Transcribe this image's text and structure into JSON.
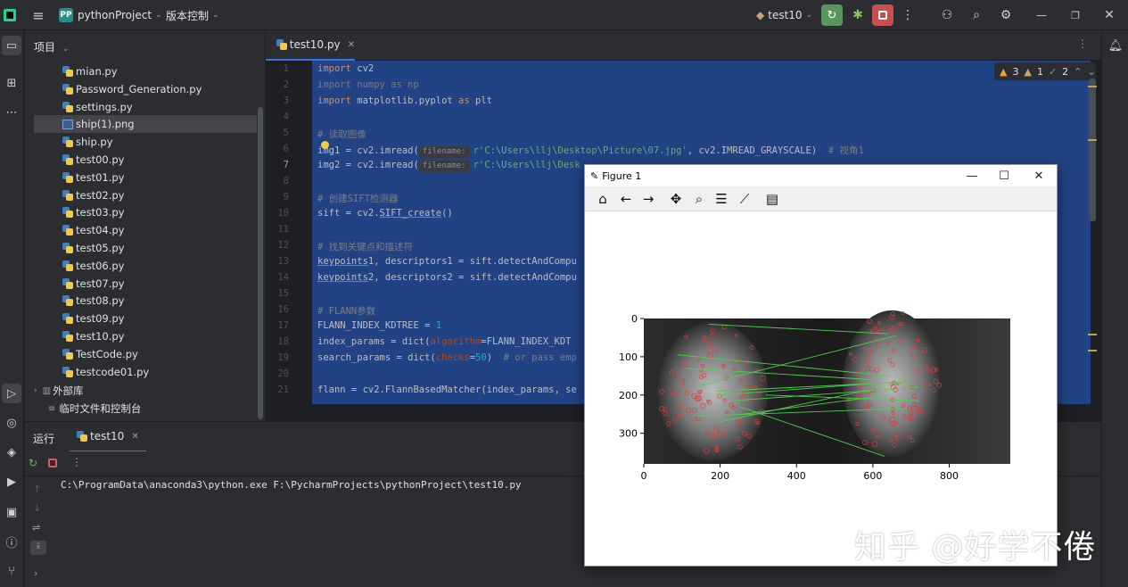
{
  "titlebar": {
    "project_badge": "PP",
    "project_name": "pythonProject",
    "vcs_label": "版本控制",
    "run_config": "test10",
    "icons": [
      "menu-icon",
      "run-icon",
      "debug-icon",
      "stop-icon",
      "more-icon",
      "add-user-icon",
      "search-icon",
      "settings-icon"
    ]
  },
  "project_panel": {
    "header": "项目",
    "files": [
      {
        "name": "mian.py",
        "type": "py"
      },
      {
        "name": "Password_Generation.py",
        "type": "py"
      },
      {
        "name": "settings.py",
        "type": "py"
      },
      {
        "name": "ship(1).png",
        "type": "png",
        "selected": true
      },
      {
        "name": "ship.py",
        "type": "py"
      },
      {
        "name": "test00.py",
        "type": "py"
      },
      {
        "name": "test01.py",
        "type": "py"
      },
      {
        "name": "test02.py",
        "type": "py"
      },
      {
        "name": "test03.py",
        "type": "py"
      },
      {
        "name": "test04.py",
        "type": "py"
      },
      {
        "name": "test05.py",
        "type": "py"
      },
      {
        "name": "test06.py",
        "type": "py"
      },
      {
        "name": "test07.py",
        "type": "py"
      },
      {
        "name": "test08.py",
        "type": "py"
      },
      {
        "name": "test09.py",
        "type": "py"
      },
      {
        "name": "test10.py",
        "type": "py"
      },
      {
        "name": "TestCode.py",
        "type": "py"
      },
      {
        "name": "testcode01.py",
        "type": "py"
      }
    ],
    "external_libs": "外部库",
    "scratches": "临时文件和控制台"
  },
  "editor": {
    "tab_label": "test10.py",
    "inspections": {
      "errors": "3",
      "warnings": "1",
      "ok": "2"
    },
    "line_numbers": [
      "1",
      "2",
      "3",
      "4",
      "5",
      "6",
      "7",
      "8",
      "9",
      "10",
      "11",
      "12",
      "13",
      "14",
      "15",
      "16",
      "17",
      "18",
      "19",
      "20",
      "21"
    ],
    "code": {
      "l1_kw": "import",
      "l1_rest": " cv2",
      "l2": "import numpy as np",
      "l3_kw": "import",
      "l3_mid": " matplotlib.pyplot ",
      "l3_kw2": "as",
      "l3_end": " plt",
      "l5": "# 读取图像",
      "l6_a": "img1 = cv2.imread(",
      "l6_hint": "filename:",
      "l6_str": "r'C:\\Users\\llj\\Desktop\\Picture\\07.jpg'",
      "l6_b": ", cv2.IMREAD_GRAYSCALE)  ",
      "l6_cm": "# 视角1",
      "l7_a": "img2 = cv2.imread(",
      "l7_hint": "filename:",
      "l7_str": "r'C:\\Users\\llj\\Desk",
      "l9": "# 创建SIFT检测器",
      "l10_a": "sift = cv2.",
      "l10_fn": "SIFT_create",
      "l10_b": "()",
      "l12": "# 找到关键点和描述符",
      "l13_kp": "keypoints",
      "l13_rest": "1, descriptors1 = sift.detectAndCompu",
      "l14_kp": "keypoints",
      "l14_rest": "2, descriptors2 = sift.detectAndCompu",
      "l16": "# FLANN参数",
      "l17_a": "FLANN_INDEX_KDTREE = ",
      "l17_n": "1",
      "l18_a": "index_params = dict(",
      "l18_p": "algorithm",
      "l18_b": "=FLANN_INDEX_KDT",
      "l19_a": "search_params = dict(",
      "l19_p": "checks",
      "l19_eq": "=",
      "l19_n": "50",
      "l19_b": ")  ",
      "l19_cm": "# or pass emp",
      "l21": "flann = cv2.FlannBasedMatcher(index_params, se"
    }
  },
  "run_panel": {
    "run_label": "运行",
    "tab_label": "test10",
    "console_line": "C:\\ProgramData\\anaconda3\\python.exe F:\\PycharmProjects\\pythonProject\\test10.py"
  },
  "figure": {
    "title": "Figure 1",
    "toolbar": [
      "home-icon",
      "back-icon",
      "forward-icon",
      "pan-icon",
      "zoom-icon",
      "configure-subplots-icon",
      "edit-axes-icon",
      "save-icon"
    ],
    "x_ticks": [
      "0",
      "200",
      "400",
      "600",
      "800"
    ],
    "y_ticks": [
      "0",
      "100",
      "200",
      "300"
    ]
  },
  "chart_data": {
    "type": "image",
    "x_range": [
      0,
      960
    ],
    "y_range": [
      380,
      0
    ],
    "x_ticks": [
      0,
      200,
      400,
      600,
      800
    ],
    "y_ticks": [
      0,
      100,
      200,
      300
    ],
    "match_lines": [
      {
        "x1": 170,
        "y1": 15,
        "x2": 640,
        "y2": 40
      },
      {
        "x1": 90,
        "y1": 95,
        "x2": 640,
        "y2": 150
      },
      {
        "x1": 150,
        "y1": 175,
        "x2": 660,
        "y2": 45
      },
      {
        "x1": 190,
        "y1": 190,
        "x2": 700,
        "y2": 165
      },
      {
        "x1": 200,
        "y1": 200,
        "x2": 600,
        "y2": 170
      },
      {
        "x1": 230,
        "y1": 215,
        "x2": 720,
        "y2": 180
      },
      {
        "x1": 140,
        "y1": 255,
        "x2": 690,
        "y2": 235
      },
      {
        "x1": 200,
        "y1": 270,
        "x2": 620,
        "y2": 180
      },
      {
        "x1": 250,
        "y1": 230,
        "x2": 630,
        "y2": 360
      },
      {
        "x1": 320,
        "y1": 200,
        "x2": 720,
        "y2": 215
      },
      {
        "x1": 110,
        "y1": 130,
        "x2": 600,
        "y2": 160
      },
      {
        "x1": 260,
        "y1": 250,
        "x2": 640,
        "y2": 200
      }
    ]
  },
  "watermark": "知乎 @好学不倦",
  "colors": {
    "accent": "#3574f0",
    "selection_bg": "#214283",
    "run_green": "#4caf50",
    "stop_red": "#db5c5c",
    "match_line": "#4bd14b",
    "keypoint": "#e23b3b"
  }
}
